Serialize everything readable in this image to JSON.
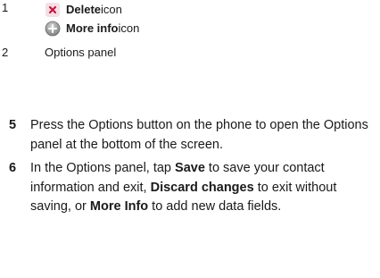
{
  "callouts": [
    {
      "number": "1",
      "items": [
        {
          "icon": "delete-icon",
          "name": "Delete",
          "suffix": " icon"
        },
        {
          "icon": "more-info-icon",
          "name": "More info",
          "suffix": " icon"
        }
      ]
    },
    {
      "number": "2",
      "text": "Options panel"
    }
  ],
  "steps": [
    {
      "number": "5",
      "text": "Press the Options button on the phone to open the Options panel at the bottom of the screen."
    },
    {
      "number": "6",
      "parts": [
        "In the Options panel, tap ",
        "Save",
        " to save your contact information and exit, ",
        "Discard changes",
        " to exit without saving, or ",
        "More Info",
        " to add new data fields."
      ]
    }
  ],
  "colors": {
    "delete_icon": "#d0143c",
    "delete_icon_bg": "#f3dfe6",
    "more_info_icon": "#8e8e8e"
  }
}
